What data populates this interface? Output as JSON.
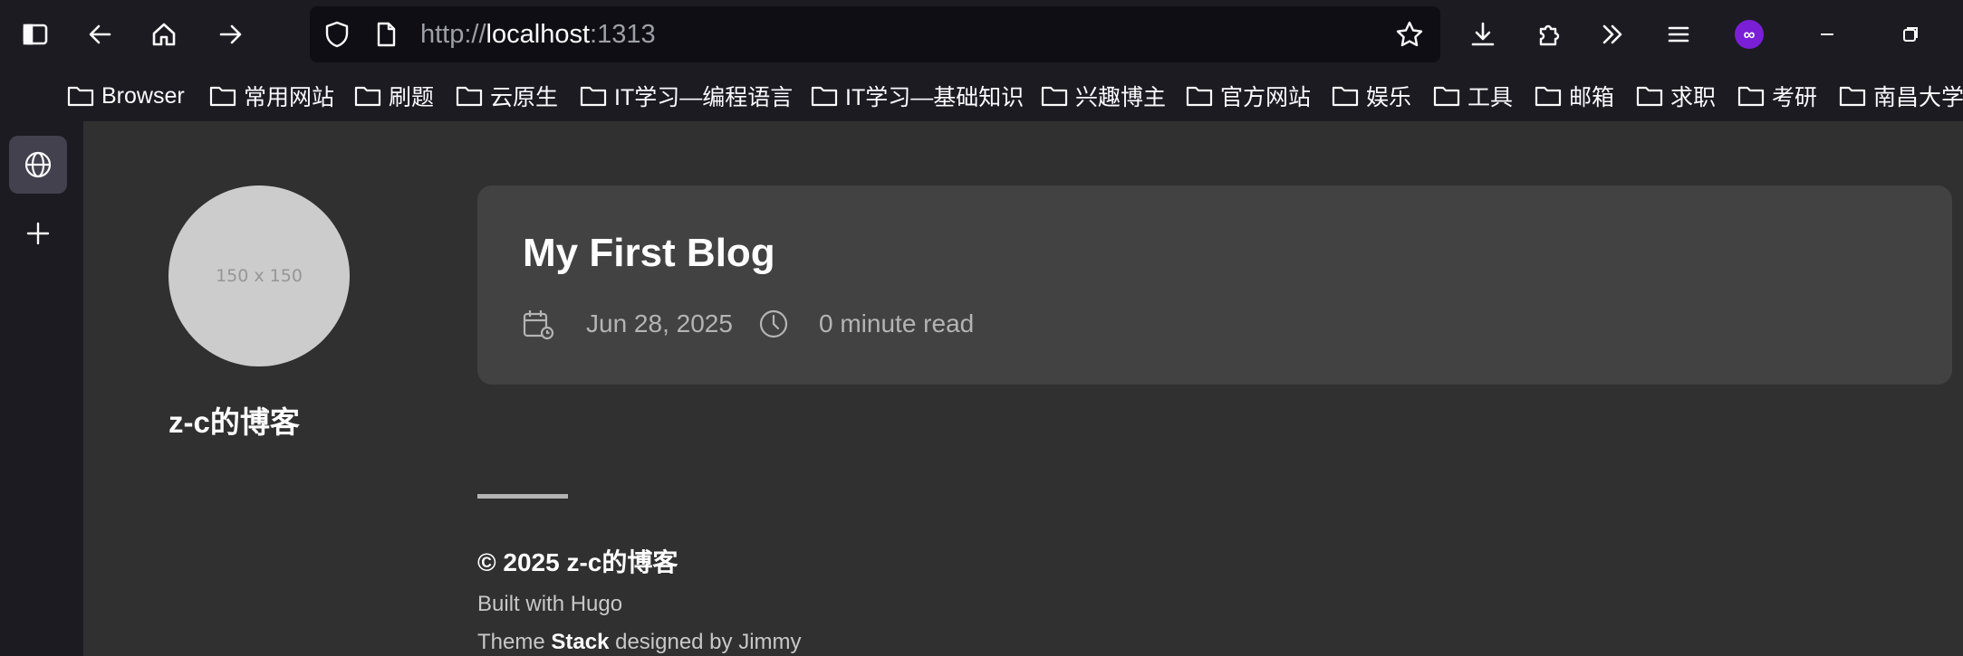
{
  "toolbar": {
    "buttons": [
      "sidebar-toggle",
      "back",
      "home",
      "forward"
    ],
    "right_buttons": [
      "downloads",
      "extensions",
      "overflow-menu",
      "app-menu",
      "private-browsing",
      "minimize",
      "restore"
    ]
  },
  "urlbar": {
    "scheme": "http://",
    "host": "localhost",
    "port": ":1313"
  },
  "bookmarks": [
    {
      "label": "Browser"
    },
    {
      "label": "常用网站"
    },
    {
      "label": "刷题"
    },
    {
      "label": "云原生"
    },
    {
      "label": "IT学习—编程语言"
    },
    {
      "label": "IT学习—基础知识"
    },
    {
      "label": "兴趣博主"
    },
    {
      "label": "官方网站"
    },
    {
      "label": "娱乐"
    },
    {
      "label": "工具"
    },
    {
      "label": "邮箱"
    },
    {
      "label": "求职"
    },
    {
      "label": "考研"
    },
    {
      "label": "南昌大学"
    }
  ],
  "page": {
    "avatar_text": "150 x 150",
    "site_name": "z-c的博客",
    "post": {
      "title": "My First Blog",
      "date": "Jun 28, 2025",
      "read_time": "0 minute read"
    },
    "footer": {
      "copyright": "© 2025 z-c的博客",
      "built_with": "Built with Hugo",
      "theme_prefix": "Theme ",
      "theme_name": "Stack",
      "theme_suffix": " designed by Jimmy"
    }
  },
  "colors": {
    "chrome_bg": "#1c1b22",
    "urlbar_bg": "#0f0e15",
    "page_bg": "#303030",
    "card_bg": "#424242",
    "avatar_bg": "#cccccc",
    "private_badge": "#7a1fd6"
  }
}
